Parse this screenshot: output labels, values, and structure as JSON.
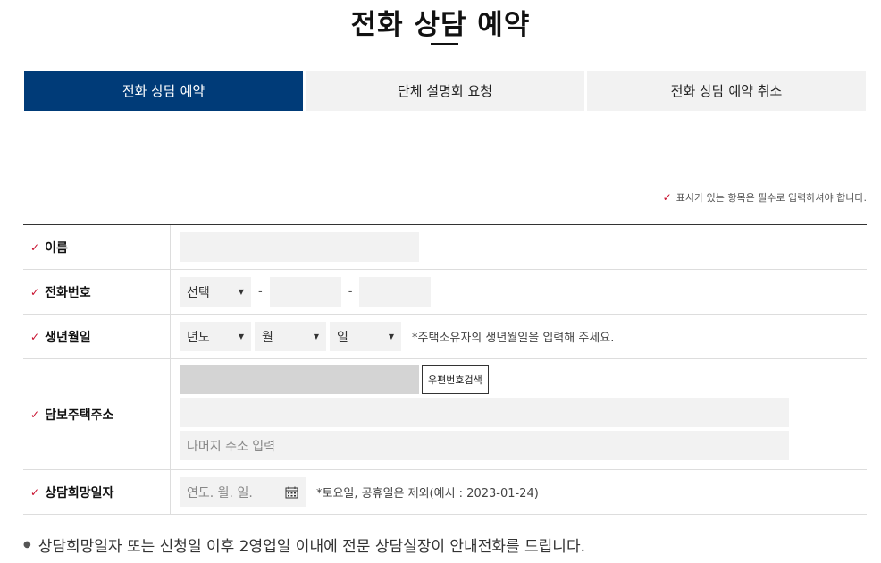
{
  "page": {
    "title": "전화 상담 예약"
  },
  "tabs": [
    {
      "label": "전화 상담 예약",
      "active": true
    },
    {
      "label": "단체 설명회 요청",
      "active": false
    },
    {
      "label": "전화 상담 예약 취소",
      "active": false
    }
  ],
  "required_note": "표시가 있는 항목은 필수로 입력하셔야 합니다.",
  "form": {
    "name": {
      "label": "이름",
      "value": ""
    },
    "phone": {
      "label": "전화번호",
      "select": "선택",
      "dash": "-",
      "mid": "",
      "last": ""
    },
    "birth": {
      "label": "생년월일",
      "year": "년도",
      "month": "월",
      "day": "일",
      "hint": "*주택소유자의 생년월일을 입력해 주세요."
    },
    "address": {
      "label": "담보주택주소",
      "postcode": "",
      "search_button": "우편번호검색",
      "line1": "",
      "line2_placeholder": "나머지 주소 입력"
    },
    "date": {
      "label": "상담희망일자",
      "placeholder": "연도. 월. 일.",
      "hint": "*토요일, 공휴일은 제외(예시 : 2023-01-24)"
    }
  },
  "bottom_note": "상담희망일자 또는 신청일 이후 2영업일 이내에 전문 상담실장이 안내전화를 드립니다.",
  "colors": {
    "tab_active": "#003b78",
    "required_mark": "#c8102e"
  },
  "icons": {
    "required": "check-icon",
    "select": "caret-down-icon",
    "calendar": "calendar-icon"
  }
}
